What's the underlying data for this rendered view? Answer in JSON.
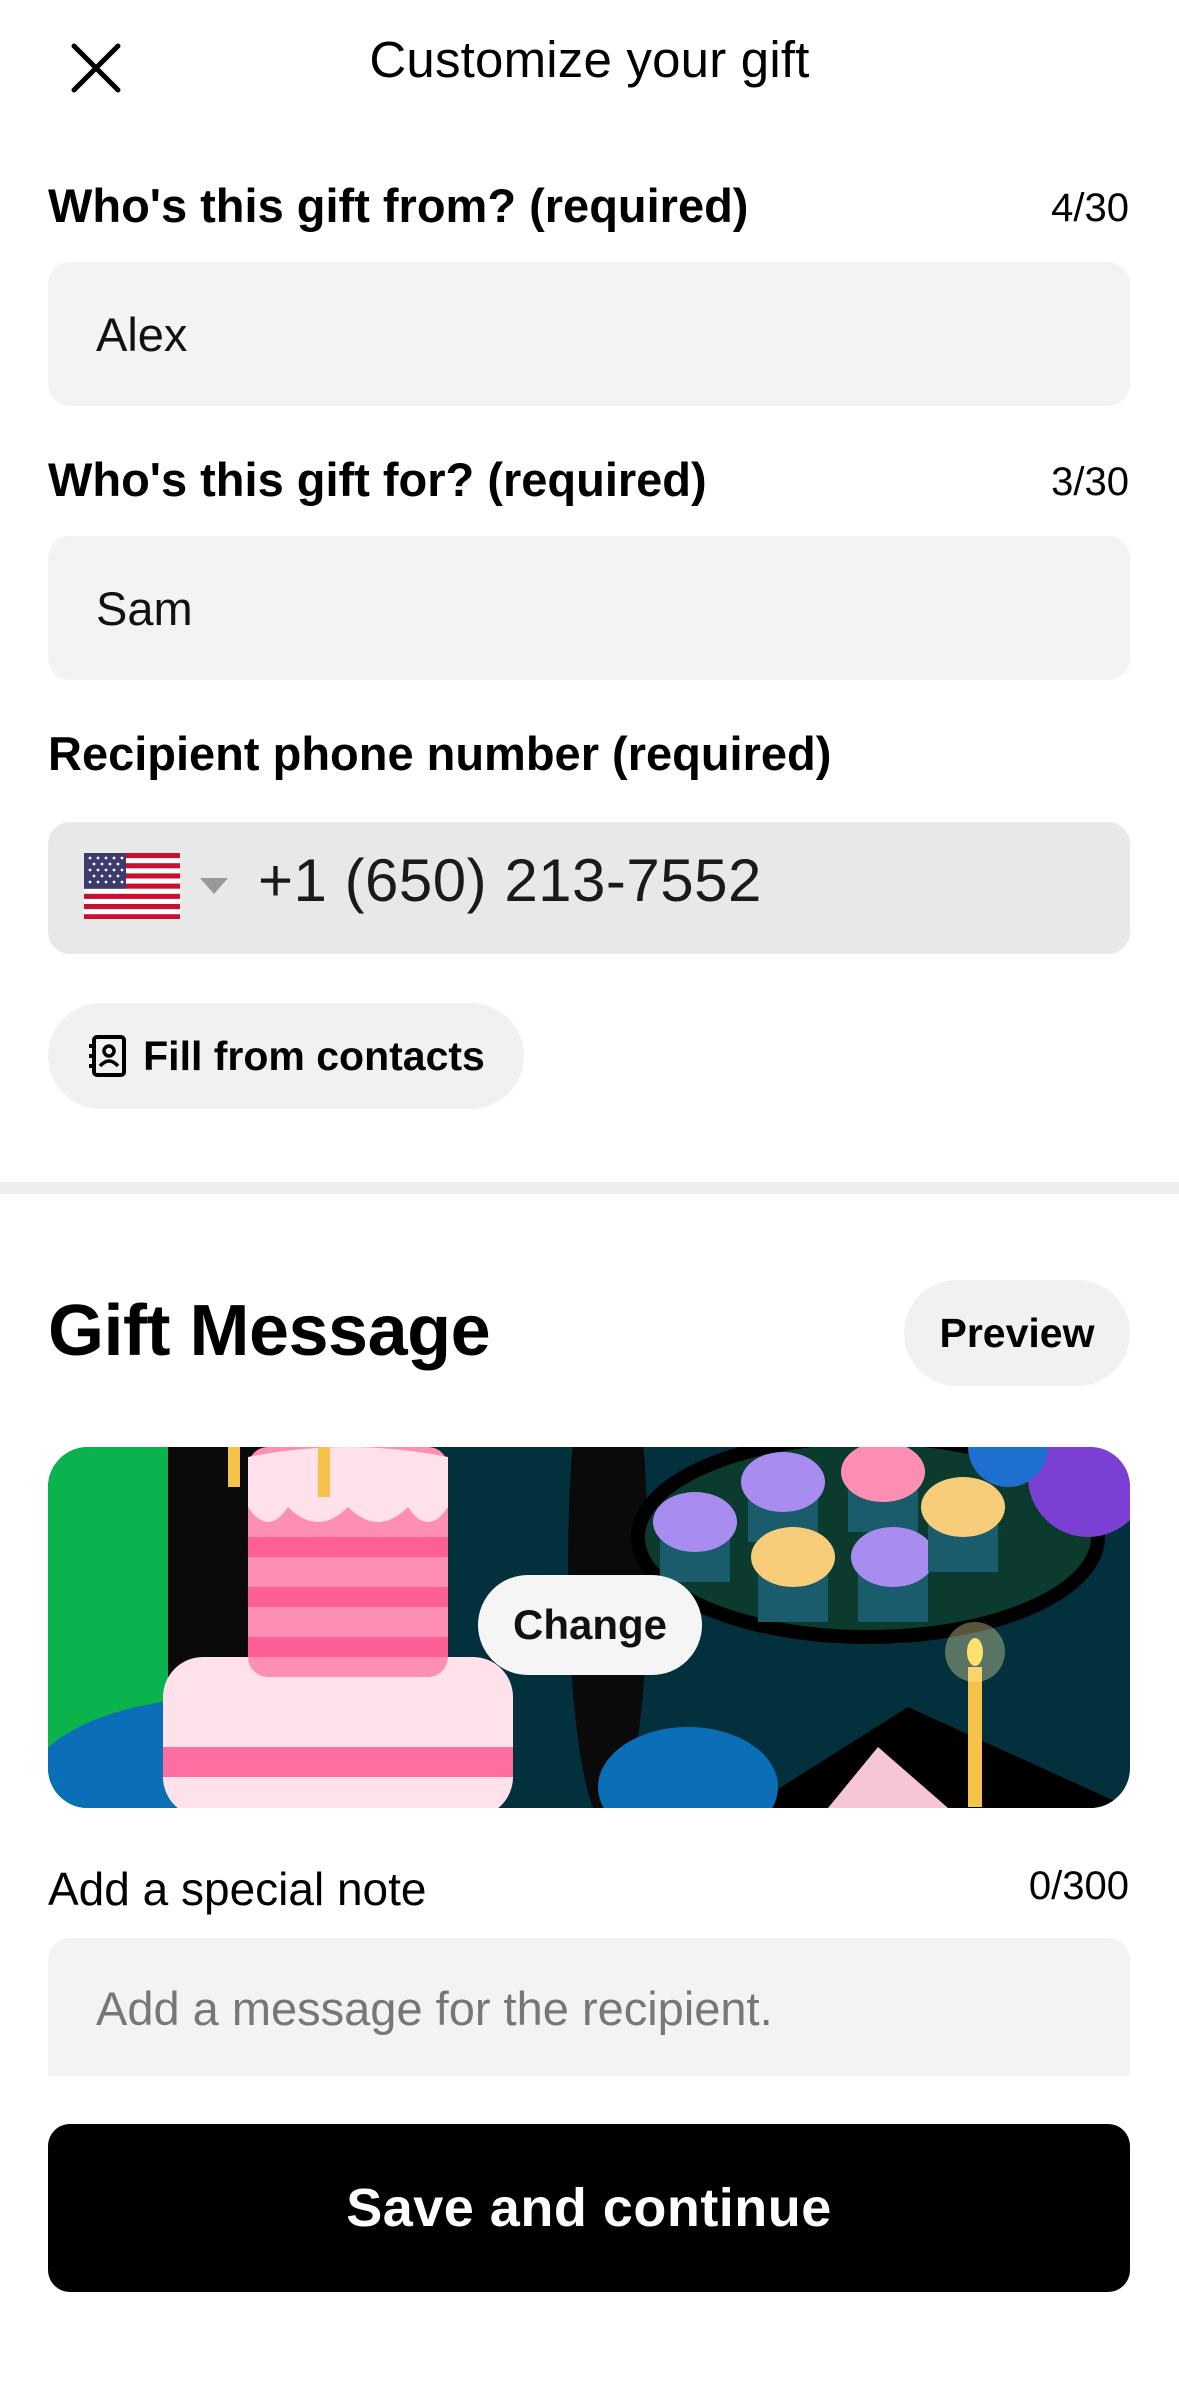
{
  "header": {
    "title": "Customize your gift",
    "close_icon": "close-icon"
  },
  "from_field": {
    "label": "Who's this gift from? (required)",
    "counter": "4/30",
    "value": "Alex"
  },
  "for_field": {
    "label": "Who's this gift for? (required)",
    "counter": "3/30",
    "value": "Sam"
  },
  "phone_field": {
    "label": "Recipient phone number (required)",
    "country_flag": "us-flag-icon",
    "value": "+1 (650) 213-7552"
  },
  "fill_contacts": {
    "label": "Fill from contacts",
    "icon": "contact-book-icon"
  },
  "gift_message": {
    "title": "Gift Message",
    "preview_label": "Preview",
    "change_label": "Change",
    "note_label": "Add a special note",
    "note_counter": "0/300",
    "note_placeholder": "Add a message for the recipient."
  },
  "footer": {
    "save_label": "Save and continue"
  },
  "colors": {
    "primary": "#000000",
    "field_bg": "#f3f3f3",
    "pill_bg": "#f1f1f1"
  }
}
